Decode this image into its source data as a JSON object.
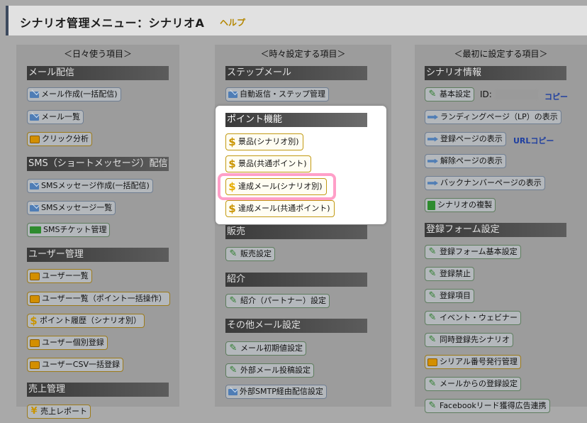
{
  "header": {
    "title": "シナリオ管理メニュー：シナリオA",
    "help": "ヘルプ"
  },
  "columns": {
    "daily": {
      "title": "＜日々使う項目＞",
      "mail_section": "メール配信",
      "mail_create": "メール作成(一括配信)",
      "mail_list": "メール一覧",
      "click_analysis": "クリック分析",
      "sms_section": "SMS（ショートメッセージ）配信",
      "sms_create": "SMSメッセージ作成(一括配信)",
      "sms_list": "SMSメッセージ一覧",
      "sms_ticket": "SMSチケット管理",
      "user_section": "ユーザー管理",
      "user_list": "ユーザー一覧",
      "user_list_bulk": "ユーザー一覧（ポイント一括操作）",
      "point_history": "ポイント履歴（シナリオ別）",
      "user_register": "ユーザー個別登録",
      "user_csv": "ユーザーCSV一括登録",
      "sales_section": "売上管理",
      "sales_report": "売上レポート"
    },
    "occasional": {
      "title": "＜時々設定する項目＞",
      "step_section": "ステップメール",
      "auto_reply": "自動返信・ステップ管理",
      "sales_section": "販売",
      "sales_settings": "販売設定",
      "intro_section": "紹介",
      "intro_settings": "紹介（パートナー）設定",
      "other_section": "その他メール設定",
      "mail_initial": "メール初期値設定",
      "external_post": "外部メール投稿設定",
      "smtp": "外部SMTP経由配信設定"
    },
    "initial": {
      "title": "＜最初に設定する項目＞",
      "scenario_section": "シナリオ情報",
      "basic_settings": "基本設定",
      "id_label": "ID:",
      "copy_link": "コピー",
      "landing_page": "ランディングページ（LP）の表示",
      "register_page": "登録ページの表示",
      "url_copy": "URLコピー",
      "cancel_page": "解除ページの表示",
      "backnumber_page": "バックナンバーページの表示",
      "duplicate": "シナリオの複製",
      "form_section": "登録フォーム設定",
      "form_basic": "登録フォーム基本設定",
      "form_ban": "登録禁止",
      "form_items": "登録項目",
      "event_webinar": "イベント・ウェビナー",
      "simultaneous": "同時登録先シナリオ",
      "serial": "シリアル番号発行管理",
      "mail_register": "メールからの登録設定",
      "facebook": "Facebookリード獲得広告連携"
    }
  },
  "popup": {
    "section": "ポイント機能",
    "prize_scenario": "景品(シナリオ別)",
    "prize_shared": "景品(共通ポイント)",
    "achieve_scenario": "達成メール(シナリオ別)",
    "achieve_shared": "達成メール(共通ポイント)"
  },
  "colors": {
    "accent_gold": "#c29a13",
    "highlight_pink": "#ff9fc8",
    "link_blue": "#1f3fa0"
  }
}
